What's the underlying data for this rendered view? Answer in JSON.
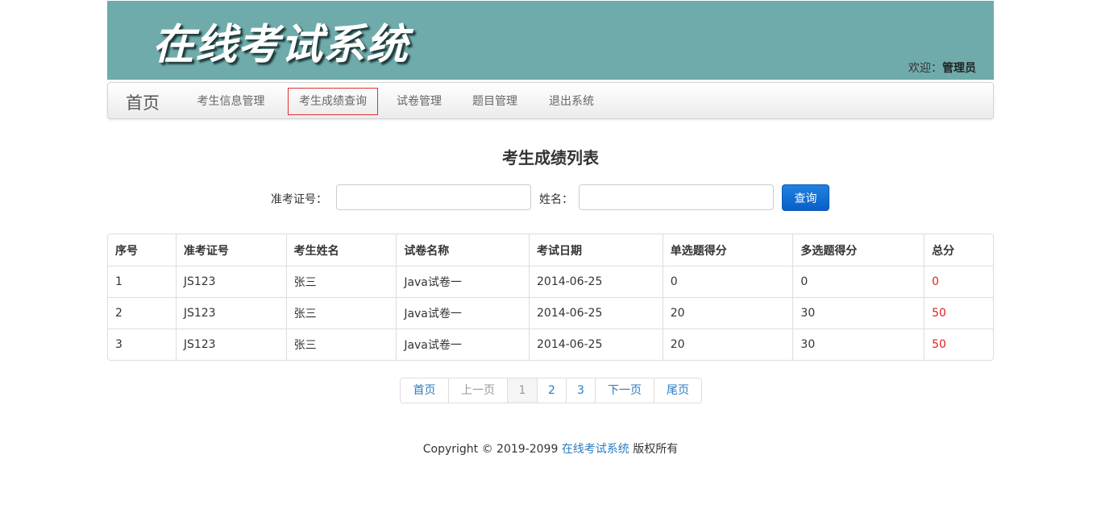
{
  "header": {
    "logo_text": "在线考试系统",
    "welcome_prefix": "欢迎：",
    "user_name": "管理员"
  },
  "nav": {
    "brand": "首页",
    "items": [
      {
        "label": "考生信息管理"
      },
      {
        "label": "考生成绩查询",
        "active": true
      },
      {
        "label": "试卷管理"
      },
      {
        "label": "题目管理"
      },
      {
        "label": "退出系统"
      }
    ]
  },
  "page": {
    "title": "考生成绩列表"
  },
  "search": {
    "id_label": "准考证号：",
    "id_value": "",
    "name_label": "姓名：",
    "name_value": "",
    "button": "查询"
  },
  "table": {
    "headers": [
      "序号",
      "准考证号",
      "考生姓名",
      "试卷名称",
      "考试日期",
      "单选题得分",
      "多选题得分",
      "总分"
    ],
    "rows": [
      [
        "1",
        "JS123",
        "张三",
        "Java试卷一",
        "2014-06-25",
        "0",
        "0",
        "0"
      ],
      [
        "2",
        "JS123",
        "张三",
        "Java试卷一",
        "2014-06-25",
        "20",
        "30",
        "50"
      ],
      [
        "3",
        "JS123",
        "张三",
        "Java试卷一",
        "2014-06-25",
        "20",
        "30",
        "50"
      ]
    ]
  },
  "pagination": {
    "first": "首页",
    "prev": "上一页",
    "pages": [
      "1",
      "2",
      "3"
    ],
    "current": "1",
    "next": "下一页",
    "last": "尾页"
  },
  "footer": {
    "copyright": "Copyright © 2019-2099",
    "brand": "在线考试系统",
    "suffix": "版权所有"
  },
  "colors": {
    "banner": "#6fabab",
    "link": "#2a7bc0",
    "total_score": "#e02020",
    "active_nav_border": "#e03131",
    "button": "#0a5ec8"
  }
}
